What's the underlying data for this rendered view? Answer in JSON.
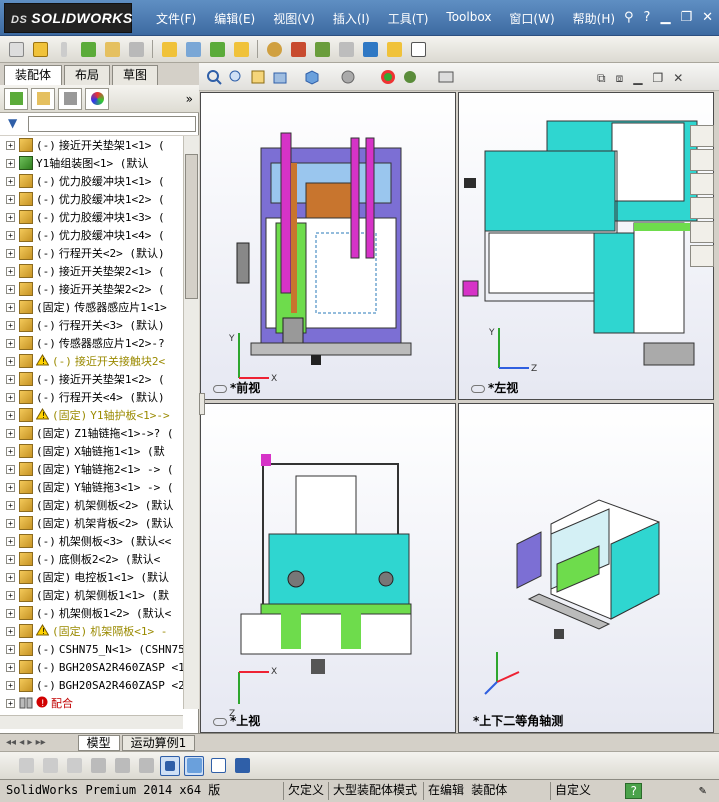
{
  "app": {
    "logo_text": "SOLIDWORKS",
    "logo_prefix": "DS"
  },
  "menu": {
    "items": [
      "文件(F)",
      "编辑(E)",
      "视图(V)",
      "插入(I)",
      "工具(T)",
      "Toolbox",
      "窗口(W)",
      "帮助(H)"
    ]
  },
  "window_controls": {
    "help": "?"
  },
  "panel_tabs": [
    "装配体",
    "布局",
    "草图"
  ],
  "tree": {
    "items": [
      {
        "prefix": "(-)",
        "label": "接近开关垫架1<1> (",
        "icon": "part",
        "status": "normal"
      },
      {
        "prefix": "",
        "label": "Y1轴组装图<1> (默认",
        "icon": "asm",
        "status": "normal"
      },
      {
        "prefix": "(-)",
        "label": "优力胶缓冲块1<1> (",
        "icon": "part",
        "status": "normal"
      },
      {
        "prefix": "(-)",
        "label": "优力胶缓冲块1<2> (",
        "icon": "part",
        "status": "normal"
      },
      {
        "prefix": "(-)",
        "label": "优力胶缓冲块1<3> (",
        "icon": "part",
        "status": "normal"
      },
      {
        "prefix": "(-)",
        "label": "优力胶缓冲块1<4> (",
        "icon": "part",
        "status": "normal"
      },
      {
        "prefix": "(-)",
        "label": "行程开关<2> (默认)",
        "icon": "part",
        "status": "normal"
      },
      {
        "prefix": "(-)",
        "label": "接近开关垫架2<1> (",
        "icon": "part",
        "status": "normal"
      },
      {
        "prefix": "(-)",
        "label": "接近开关垫架2<2> (",
        "icon": "part",
        "status": "normal"
      },
      {
        "prefix": "(固定)",
        "label": "传感器感应片1<1>",
        "icon": "part",
        "status": "normal"
      },
      {
        "prefix": "(-)",
        "label": "行程开关<3> (默认)",
        "icon": "part",
        "status": "normal"
      },
      {
        "prefix": "(-)",
        "label": "传感器感应片1<2>-?",
        "icon": "part",
        "status": "normal"
      },
      {
        "prefix": "(-)",
        "label": "接近开关接触块2<",
        "icon": "part",
        "status": "warning"
      },
      {
        "prefix": "(-)",
        "label": "接近开关垫架1<2> (",
        "icon": "part",
        "status": "normal"
      },
      {
        "prefix": "(-)",
        "label": "行程开关<4> (默认)",
        "icon": "part",
        "status": "normal"
      },
      {
        "prefix": "(固定)",
        "label": "Y1轴护板<1>->",
        "icon": "part",
        "status": "warning"
      },
      {
        "prefix": "(固定)",
        "label": "Z1轴链拖<1>->? (",
        "icon": "part",
        "status": "normal"
      },
      {
        "prefix": "(固定)",
        "label": "X轴链拖1<1> (默",
        "icon": "part",
        "status": "normal"
      },
      {
        "prefix": "(固定)",
        "label": "Y轴链拖2<1> -> (",
        "icon": "part",
        "status": "normal"
      },
      {
        "prefix": "(固定)",
        "label": "Y轴链拖3<1> -> (",
        "icon": "part",
        "status": "normal"
      },
      {
        "prefix": "(固定)",
        "label": "机架侧板<2> (默认",
        "icon": "part",
        "status": "normal"
      },
      {
        "prefix": "(固定)",
        "label": "机架背板<2> (默认",
        "icon": "part",
        "status": "normal"
      },
      {
        "prefix": "(-)",
        "label": "机架侧板<3> (默认<<",
        "icon": "part",
        "status": "normal"
      },
      {
        "prefix": "(-)",
        "label": "底侧板2<2> (默认<",
        "icon": "part",
        "status": "normal"
      },
      {
        "prefix": "(固定)",
        "label": "电控板1<1> (默认",
        "icon": "part",
        "status": "normal"
      },
      {
        "prefix": "(固定)",
        "label": "机架侧板1<1> (默",
        "icon": "part",
        "status": "normal"
      },
      {
        "prefix": "(-)",
        "label": "机架侧板1<2> (默认<",
        "icon": "part",
        "status": "normal"
      },
      {
        "prefix": "(固定)",
        "label": "机架隔板<1> -",
        "icon": "part",
        "status": "warning"
      },
      {
        "prefix": "(-)",
        "label": "CSHN75_N<1> (CSHN75",
        "icon": "part",
        "status": "normal"
      },
      {
        "prefix": "(-)",
        "label": "BGH20SA2R460ZASP <1",
        "icon": "part",
        "status": "normal"
      },
      {
        "prefix": "(-)",
        "label": "BGH20SA2R460ZASP <2",
        "icon": "part",
        "status": "normal"
      },
      {
        "prefix": "",
        "label": "配合",
        "icon": "mate",
        "status": "error"
      }
    ]
  },
  "viewports": [
    {
      "label": "*前视",
      "id": "front"
    },
    {
      "label": "*左视",
      "id": "left"
    },
    {
      "label": "*上视",
      "id": "top"
    },
    {
      "label": "*上下二等角轴测",
      "id": "iso"
    }
  ],
  "bottom_tabs": [
    "模型",
    "运动算例1"
  ],
  "status": {
    "product": "SolidWorks Premium 2014 x64 版",
    "underdefined": "欠定义",
    "large_assembly": "大型装配体模式",
    "editing": "在编辑 装配体",
    "custom": "自定义",
    "help": "?"
  },
  "colors": {
    "accent_blue": "#3d6aa1",
    "cyan_panel": "#2fd6d0",
    "magenta_part": "#d633c7",
    "green_part": "#6edc4c",
    "brown_part": "#c8752e",
    "violet_part": "#7c6fd4",
    "warning": "#9a8a00",
    "error": "#c00000"
  }
}
